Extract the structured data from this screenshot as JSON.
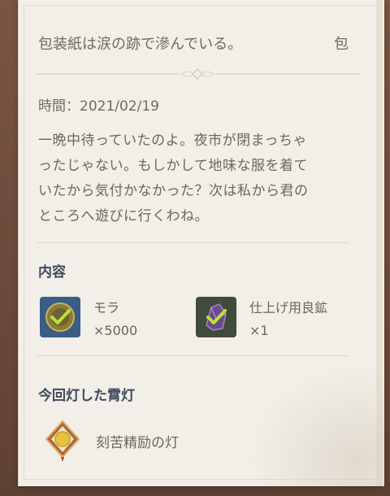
{
  "mail": {
    "subject": "包装紙は涙の跡で滲んでいる。",
    "subject_tail": "包",
    "date_label": "時間：",
    "date_value": "2021/02/19",
    "body_lines": [
      "一晩中待っていたのよ。夜市が閉まっちゃ",
      "ったじゃない。もしかして地味な服を着て",
      "いたから気付かなかった？次は私から君の",
      "ところへ遊びに行くわね。"
    ]
  },
  "contents": {
    "title": "内容",
    "items": [
      {
        "name": "モラ",
        "quantity": "×5000",
        "icon": "mora-coin-icon",
        "claimed": true
      },
      {
        "name": "仕上げ用良鉱",
        "quantity": "×1",
        "icon": "fine-enhancement-ore-icon",
        "claimed": true
      }
    ]
  },
  "lantern_section": {
    "title": "今回灯した霄灯",
    "lantern_name": "刻苦精励の灯",
    "icon": "lantern-icon"
  },
  "colors": {
    "paper": "#f2efe8",
    "text": "#6c665d",
    "heading": "#3e4a5c",
    "check": "#b9e23a"
  }
}
